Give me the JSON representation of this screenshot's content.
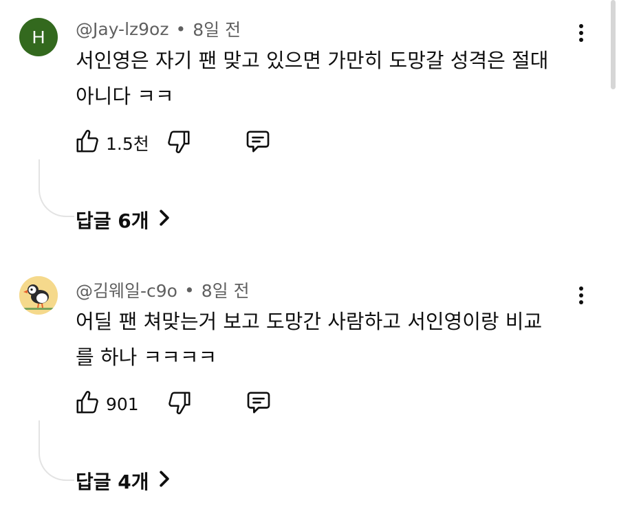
{
  "comments": [
    {
      "avatar_letter": "H",
      "author": "@Jay-lz9oz",
      "separator": "•",
      "time": "8일 전",
      "text_line1": "서인영은 자기 팬 맞고 있으면 가만히 도망갈 성격은 절대",
      "text_line2": "아니다 ㅋㅋ",
      "likes": "1.5천",
      "replies_label": "답글 6개",
      "avatar_color": "#33691e"
    },
    {
      "avatar_icon": "puffin-avatar-icon",
      "author": "@김웨일-c9o",
      "separator": "•",
      "time": "8일 전",
      "text_line1": "어딜 팬 쳐맞는거 보고 도망간 사람하고 서인영이랑 비교",
      "text_line2": "를 하나 ㅋㅋㅋㅋ",
      "likes": "901",
      "replies_label": "답글 4개",
      "avatar_color": "#f5d98c"
    }
  ],
  "icons": {
    "like": "thumbs-up-icon",
    "dislike": "thumbs-down-icon",
    "reply": "reply-comment-icon",
    "more": "more-vertical-icon",
    "chevron": "chevron-right-icon"
  }
}
